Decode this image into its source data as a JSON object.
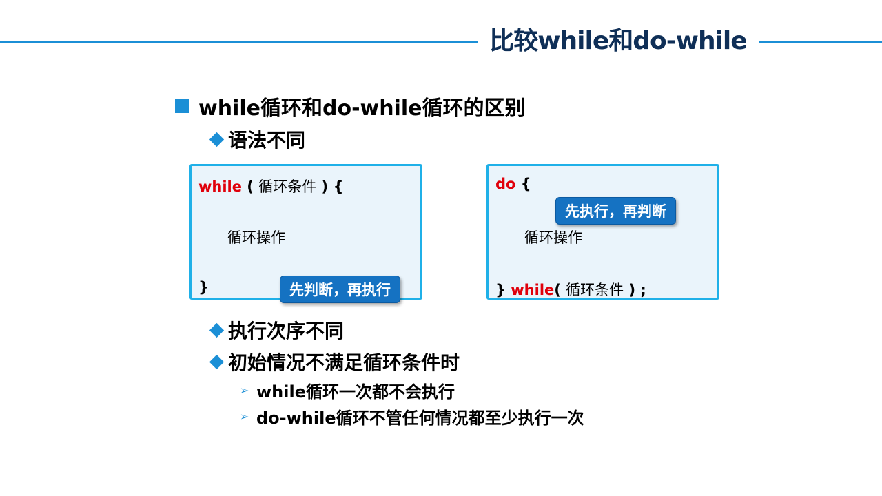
{
  "title": "比较while和do-while",
  "heading": "while循环和do-while循环的区别",
  "sub_points": [
    "语法不同",
    "执行次序不同",
    "初始情况不满足循环条件时"
  ],
  "details": [
    "while循环一次都不会执行",
    "do-while循环不管任何情况都至少执行一次"
  ],
  "left_code": {
    "kw": "while",
    "open_paren": " ( ",
    "cond": "循环条件",
    "close": " ) {",
    "body": "循环操作",
    "end": "}",
    "callout": "先判断，再执行"
  },
  "right_code": {
    "kw": "do",
    "open": " {",
    "body": "循环操作",
    "close_brace": "} ",
    "kw2": "while",
    "open_paren": "( ",
    "cond": "循环条件",
    "end": " ) ;",
    "callout": "先执行，再判断"
  },
  "colors": {
    "accent": "#1b8fd6",
    "keyword": "#e0000b",
    "callout_bg": "#1572c2",
    "title": "#0f2f57"
  }
}
